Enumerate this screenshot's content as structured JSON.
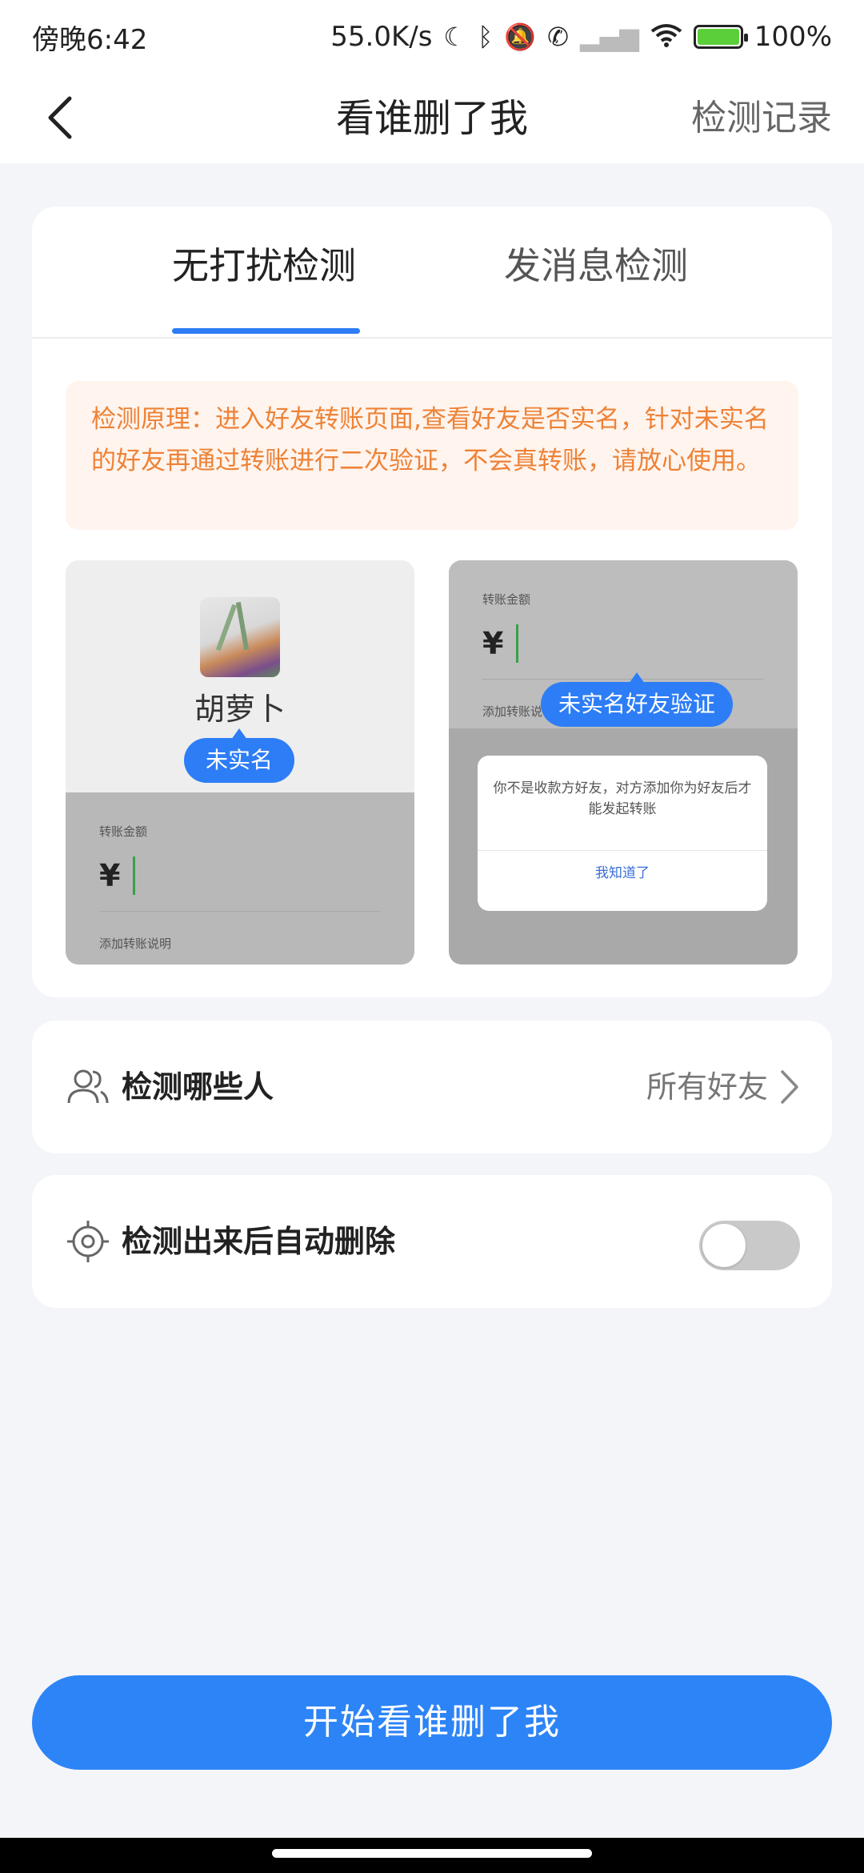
{
  "status_bar": {
    "time": "傍晚6:42",
    "network_speed": "55.0K/s",
    "battery_percent": "100%",
    "icons": [
      "moon-icon",
      "bluetooth-icon",
      "mute-icon",
      "call-icon",
      "signal-icon",
      "wifi-icon",
      "battery-icon"
    ]
  },
  "app_bar": {
    "title": "看谁删了我",
    "history_label": "检测记录"
  },
  "tabs": [
    {
      "label": "无打扰检测",
      "selected": true
    },
    {
      "label": "发消息检测",
      "selected": false
    }
  ],
  "notice": {
    "text": "检测原理：进入好友转账页面,查看好友是否实名，针对未实名的好友再通过转账进行二次验证，不会真转账，请放心使用。"
  },
  "demo_left": {
    "contact_name": "胡萝卜",
    "badge": "未实名",
    "amount_label": "转账金额",
    "currency": "¥",
    "note_label": "添加转账说明"
  },
  "demo_right": {
    "amount_label": "转账金额",
    "currency": "¥",
    "note_label": "添加转账说",
    "badge": "未实名好友验证",
    "dialog_text": "你不是收款方好友，对方添加你为好友后才能发起转账",
    "dialog_button": "我知道了"
  },
  "settings": {
    "targets": {
      "label": "检测哪些人",
      "value": "所有好友"
    },
    "auto_delete": {
      "label": "检测出来后自动删除",
      "enabled": false
    }
  },
  "primary_button": {
    "label": "开始看谁删了我"
  },
  "colors": {
    "accent": "#2d7df6",
    "notice_text": "#ee8236",
    "notice_bg": "#fff4ee",
    "page_bg": "#f4f5f9"
  }
}
